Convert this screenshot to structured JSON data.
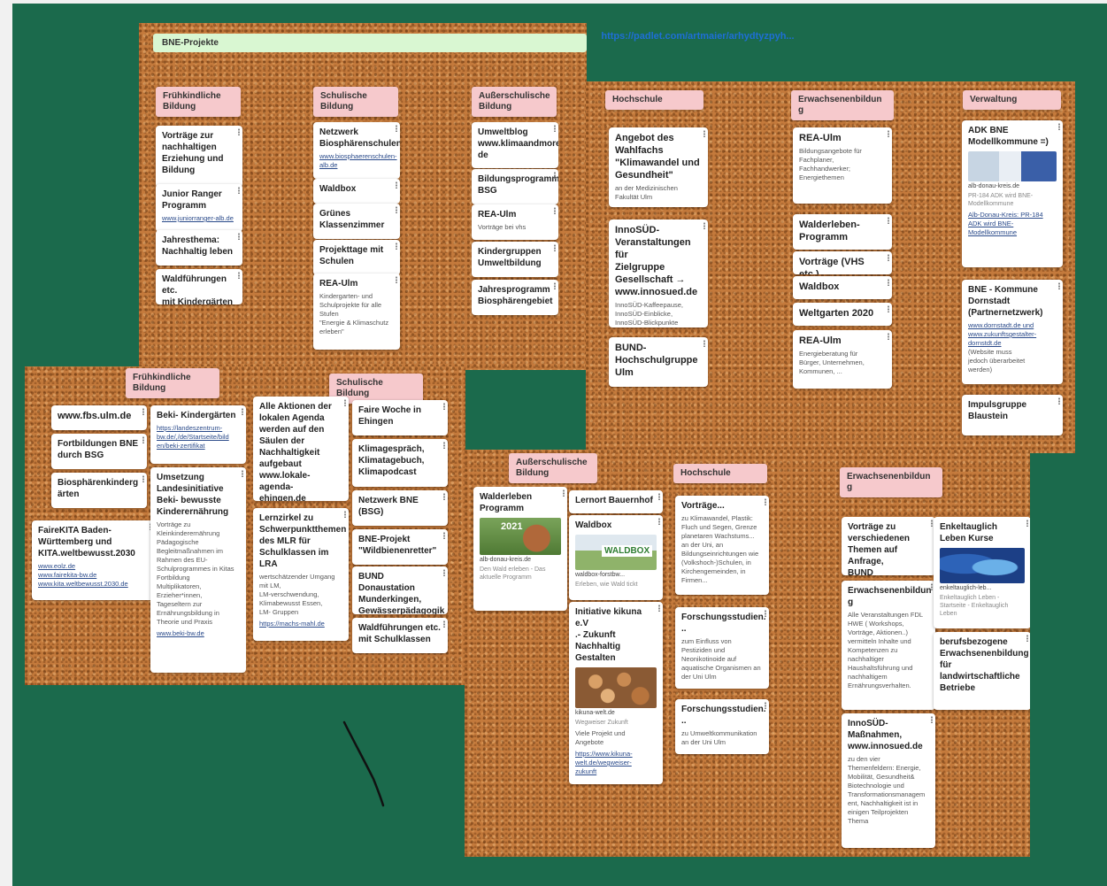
{
  "link_text": "https://padlet.com/artmaier/arhydtyzpyh...",
  "boardA": {
    "title": "BNE-Projekte",
    "col1": {
      "header": "Frühkindliche\nBildung",
      "cards": [
        {
          "title": "Vorträge zur\nnachhaltigen\nErziehung und\nBildung"
        },
        {
          "title": "Junior Ranger\nProgramm",
          "link": "www.juniorranger-alb.de"
        },
        {
          "title": "Jahresthema:\nNachhaltig leben"
        },
        {
          "title": "Waldführungen etc.\nmit Kindergärten"
        }
      ]
    },
    "col2": {
      "header": "Schulische Bildung",
      "cards": [
        {
          "title": "Netzwerk\nBiosphärenschulen,",
          "link": "www.biosphaerenschulen-\nalb.de"
        },
        {
          "title": "Waldbox"
        },
        {
          "title": "Grünes\nKlassenzimmer"
        },
        {
          "title": "Projekttage mit\nSchulen"
        },
        {
          "title": "REA-Ulm",
          "body": "Kindergarten- und\nSchulprojekte für alle\nStufen\n\"Energie & Klimaschutz\nerleben\""
        }
      ]
    },
    "col3": {
      "header": "Außerschulische\nBildung",
      "cards": [
        {
          "title": "Umweltblog\nwww.klimaandmore.\nde"
        },
        {
          "title": "Bildungsprogramm\nBSG"
        },
        {
          "title": "REA-Ulm",
          "body": "Vorträge bei vhs"
        },
        {
          "title": "Kindergruppen\nUmweltbildung"
        },
        {
          "title": "Jahresprogramm\nBiosphärengebiet"
        }
      ]
    }
  },
  "boardB": {
    "col1": {
      "header": "Hochschule",
      "cards": [
        {
          "title": "Angebot des\nWahlfachs\n\"Klimawandel und\nGesundheit\"",
          "body": "an der Medizinischen\nFakultät Ulm"
        },
        {
          "title": "InnoSÜD-\nVeranstaltungen für\nZielgruppe\nGesellschaft →\nwww.innosued.de",
          "body": "InnoSÜD-Kaffeepause,\nInnoSÜD-Einblicke,\nInnoSÜD-Blickpunkte"
        },
        {
          "title": "BUND-\nHochschulgruppe\nUlm"
        }
      ]
    },
    "col2": {
      "header": "Erwachsenenbildun\ng",
      "cards": [
        {
          "title": "REA-Ulm",
          "body": "Bildungsangebote für\nFachplaner,\nFachhandwerker;\nEnergiethemen"
        },
        {
          "title": "Walderleben-\nProgramm"
        },
        {
          "title": "Vorträge (VHS etc.)"
        },
        {
          "title": "Waldbox"
        },
        {
          "title": "Weltgarten 2020"
        },
        {
          "title": "REA-Ulm",
          "body": "Energieberatung für\nBürger, Unternehmen,\nKommunen, ..."
        }
      ]
    },
    "col3": {
      "header": "Verwaltung",
      "cards": [
        {
          "title": "ADK BNE\nModellkommune =)",
          "imgcap": "alb-donau-kreis.de",
          "meta": "PR-184 ADK wird BNE-\nModellkommune",
          "link": "Alb-Donau-Kreis: PR-184\nADK wird BNE-\nModellkommune"
        },
        {
          "title": "BNE - Kommune\nDornstadt\n(Partnernetzwerk)",
          "link": "www.dornstadt.de und\nwww.zukunftsgestalter-\ndornstdt.de",
          "body": "(Website muss\njedoch überarbeitet\nwerden)"
        },
        {
          "title": "Impulsgruppe\nBlaustein"
        }
      ]
    }
  },
  "boardC": {
    "hdr1": "Frühkindliche\nBildung",
    "hdr2": "Schulische Bildung",
    "col1": [
      {
        "title": "www.fbs.ulm.de"
      },
      {
        "title": "Fortbildungen BNE\ndurch BSG"
      },
      {
        "title": "Biosphärenkinderg\närten"
      },
      {
        "title": "FaireKITA Baden-\nWürttemberg und\nKITA.weltbewusst.2030",
        "link": "www.eolz.de\nwww.fairekita-bw.de\nwww.kita.weltbewusst.2030.de"
      }
    ],
    "col2": [
      {
        "title": "Beki- Kindergärten",
        "link": "https://landeszentrum-\nbw.de/,/de/Startseite/bild\nen/beki-zertifikat"
      },
      {
        "title": "Umsetzung\nLandesinitiative\nBeki- bewusste\nKinderernährung",
        "body": "Vorträge zu\nKleinkinderernährung\nPädagogische\nBegleitmaßnahmen im\nRahmen des EU-\nSchulprogrammes in Kitas\nFortbildung\nMultiplikatoren,\nErzieher*innen,\nTageseltern zur\nErnährungsbildung in\nTheorie  und Praxis",
        "link": "www.beki-bw.de"
      }
    ],
    "col3": [
      {
        "title": "Alle Aktionen der\nlokalen Agenda\nwerden auf den\nSäulen der\nNachhaltigkeit\naufgebaut\nwww.lokale-agenda-\nehingen.de"
      },
      {
        "title": "Lernzirkel zu\nSchwerpunktthemen\ndes MLR für\nSchulklassen im LRA",
        "body": "wertschätzender Umgang\nmit LM,\nLM-verschwendung,\nKlimabewusst Essen,\nLM- Gruppen",
        "link": "https://machs-mahl.de"
      }
    ],
    "col4": [
      {
        "title": "Faire Woche in\nEhingen"
      },
      {
        "title": "Klimagespräch,\nKlimatagebuch,\nKlimapodcast"
      },
      {
        "title": "Netzwerk BNE\n(BSG)"
      },
      {
        "title": "BNE-Projekt\n\"Wildbienenretter\""
      },
      {
        "title": "BUND Donaustation\nMunderkingen,\nGewässerpädagogik"
      },
      {
        "title": "Waldführungen etc.\nmit Schulklassen"
      }
    ]
  },
  "boardD": {
    "hdr1": "Außerschulische\nBildung",
    "hdr2": "Hochschule",
    "hdr3": "Erwachsenenbildun\ng",
    "col1": [
      {
        "title": "Walderleben\nProgramm",
        "imgtext": "2021",
        "imgcap": "alb-donau-kreis.de",
        "meta": "Den Wald erleben - Das\naktuelle Programm"
      }
    ],
    "col2": [
      {
        "title": "Lernort Bauernhof"
      },
      {
        "title": "Waldbox",
        "imgtext": "WALDBOX",
        "imgcap": "waldbox-forstbw...",
        "meta": "Erleben, wie Wald tickt"
      },
      {
        "title": "Initiative kikuna e.V\n.- Zukunft\nNachhaltig Gestalten",
        "imgcap": "kikuna-welt.de",
        "meta": "Wegweiser Zukunft",
        "body": "Viele Projekt und\nAngebote",
        "link": "https://www.kikuna-\nwelt.de/wegweiser-\nzukunft"
      }
    ],
    "col3": [
      {
        "title": "Vorträge...",
        "body": "zu Klimawandel, Plastik:\nFluch und Segen, Grenze\nplanetaren Wachstums...\nan der Uni, an\nBildungseinrichtungen wie\n(Volkshoch-)Schulen, in\nKirchengemeinden, in\nFirmen..."
      },
      {
        "title": "Forschungsstudien.\n..",
        "body": "zum Einfluss von\nPestiziden und\nNeonikotinoide auf\naquatische Organismen an\nder Uni Ulm"
      },
      {
        "title": "Forschungsstudien.\n..",
        "body": "zu Umweltkommunikation\nan der Uni Ulm"
      }
    ],
    "col4": [
      {
        "title": "Vorträge zu\nverschiedenen\nThemen auf Anfrage,\nBUND"
      },
      {
        "title": "Erwachsenenbildun\ng",
        "body": "Alle Veranstaltungen FDL\nHWE ( Workshops,\nVorträge, Aktionen..)\nvermitteln Inhalte und\nKompetenzen zu\nnachhaltiger\nHaushaltsführung und\nnachhaltigem\nErnährungsverhalten."
      },
      {
        "title": "InnoSÜD-\nMaßnahmen,\nwww.innosued.de",
        "body": "zu den vier\nThemenfeldern: Energie,\nMobilität, Gesundheit&\nBiotechnologie und\nTransformationsmanagem\nent, Nachhaltigkeit ist in\neinigen Teilprojekten\nThema"
      }
    ],
    "col5": [
      {
        "title": "Enkeltauglich\nLeben Kurse",
        "imgcap": "enkeltauglich-leb...",
        "meta": "Enkeltauglich Leben -\nStartseite - Enkeltauglich\nLeben"
      },
      {
        "title": "berufsbezogene\nErwachsenenbildung\nfür\nlandwirtschaftliche\nBetriebe"
      }
    ]
  }
}
